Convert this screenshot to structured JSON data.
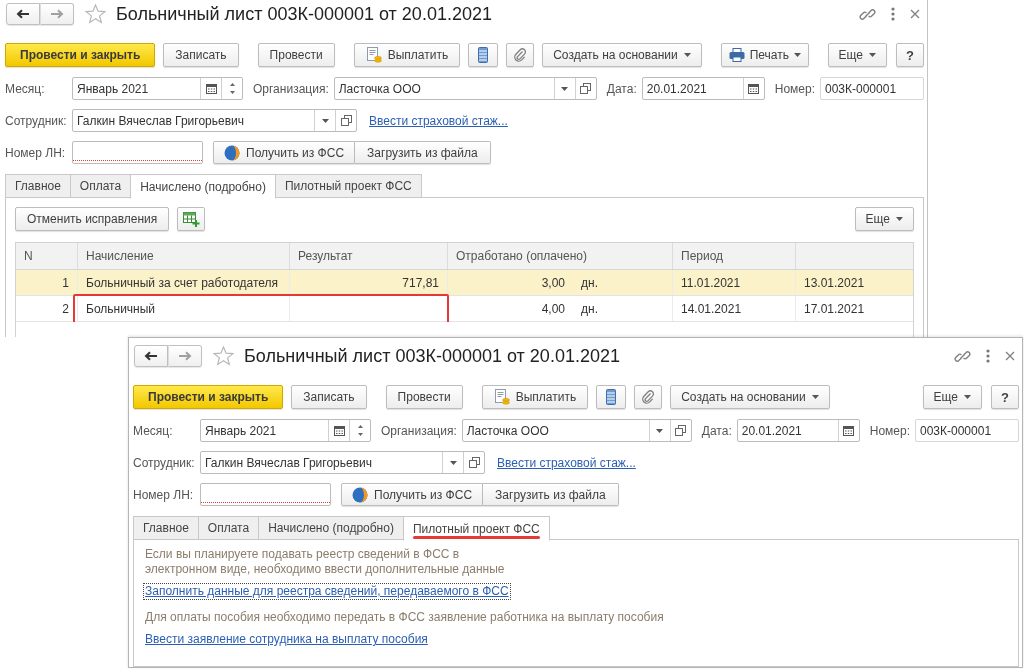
{
  "windows": [
    {
      "nav_buttons": [
        {
          "kind": "back",
          "disabled": false
        },
        {
          "kind": "forward",
          "disabled": true
        }
      ],
      "title": "Больничный лист 003К-000001 от 20.01.2021",
      "toolbar": [
        {
          "kind": "default",
          "label": "Провести и закрыть"
        },
        {
          "kind": "plain",
          "label": "Записать"
        },
        {
          "kind": "plain",
          "label": "Провести"
        },
        {
          "kind": "pay",
          "label": "Выплатить"
        },
        {
          "kind": "list"
        },
        {
          "kind": "attach"
        },
        {
          "kind": "menu",
          "label": "Создать на основании"
        },
        {
          "kind": "print",
          "label": "Печать"
        }
      ],
      "toolbar_right": [
        {
          "kind": "menu",
          "label": "Еще"
        },
        {
          "kind": "plain",
          "label": "?"
        }
      ],
      "month": {
        "label": "Месяц:",
        "value": "Январь 2021"
      },
      "organization": {
        "label": "Организация:",
        "value": "Ласточка ООО"
      },
      "date": {
        "label": "Дата:",
        "value": "20.01.2021"
      },
      "number": {
        "label": "Номер:",
        "value": "003К-000001"
      },
      "employee": {
        "label": "Сотрудник:",
        "value": "Галкин Вячеслав Григорьевич"
      },
      "insurance_link": "Ввести страховой стаж...",
      "sick_leave_number": {
        "label": "Номер ЛН:",
        "required": true
      },
      "fss_buttons": [
        {
          "kind": "fss",
          "label": "Получить из ФСС"
        },
        {
          "kind": "plain",
          "label": "Загрузить из файла"
        }
      ],
      "tabs": [
        {
          "label": "Главное",
          "selected": false,
          "marked": false
        },
        {
          "label": "Оплата",
          "selected": false,
          "marked": false
        },
        {
          "label": "Начислено (подробно)",
          "selected": true,
          "marked": false
        },
        {
          "label": "Пилотный проект ФСС",
          "selected": false,
          "marked": false
        }
      ],
      "body": {
        "kind": "accruals",
        "toolbar": [
          {
            "kind": "plain",
            "label": "Отменить исправления"
          },
          {
            "kind": "add"
          }
        ],
        "toolbar_right": [
          {
            "kind": "menu",
            "label": "Еще"
          }
        ],
        "columns": [
          "N",
          "Начисление",
          "Результат",
          "Отработано (оплачено)",
          "Период"
        ],
        "rows": [
          {
            "selected": true,
            "marked": false,
            "n": "1",
            "accrual": "Больничный за счет работодателя",
            "result": "717,81",
            "worked": "3,00",
            "unit": "дн.",
            "period": "11.01.2021",
            "column_7": "13.01.2021"
          },
          {
            "selected": false,
            "marked": true,
            "n": "2",
            "accrual": "Больничный",
            "worked": "4,00",
            "unit": "дн.",
            "period": "14.01.2021",
            "column_7": "17.01.2021"
          }
        ]
      }
    },
    {
      "nav_buttons": [
        {
          "kind": "back",
          "disabled": false
        },
        {
          "kind": "forward",
          "disabled": true
        }
      ],
      "title": "Больничный лист 003К-000001 от 20.01.2021",
      "toolbar": [
        {
          "kind": "default",
          "label": "Провести и закрыть"
        },
        {
          "kind": "plain",
          "label": "Записать"
        },
        {
          "kind": "plain",
          "label": "Провести"
        },
        {
          "kind": "pay",
          "label": "Выплатить"
        },
        {
          "kind": "list"
        },
        {
          "kind": "attach"
        },
        {
          "kind": "menu",
          "label": "Создать на основании"
        }
      ],
      "toolbar_right": [
        {
          "kind": "menu",
          "label": "Еще"
        },
        {
          "kind": "plain",
          "label": "?"
        }
      ],
      "month": {
        "label": "Месяц:",
        "value": "Январь 2021"
      },
      "organization": {
        "label": "Организация:",
        "value": "Ласточка ООО"
      },
      "date": {
        "label": "Дата:",
        "value": "20.01.2021"
      },
      "number": {
        "label": "Номер:",
        "value": "003К-000001"
      },
      "employee": {
        "label": "Сотрудник:",
        "value": "Галкин Вячеслав Григорьевич"
      },
      "insurance_link": "Ввести страховой стаж...",
      "sick_leave_number": {
        "label": "Номер ЛН:",
        "required": true
      },
      "fss_buttons": [
        {
          "kind": "fss",
          "label": "Получить из ФСС"
        },
        {
          "kind": "plain",
          "label": "Загрузить из файла"
        }
      ],
      "tabs": [
        {
          "label": "Главное",
          "selected": false,
          "marked": false
        },
        {
          "label": "Оплата",
          "selected": false,
          "marked": false
        },
        {
          "label": "Начислено (подробно)",
          "selected": false,
          "marked": false
        },
        {
          "label": "Пилотный проект ФСС",
          "selected": true,
          "marked": true
        }
      ],
      "body": {
        "kind": "notes",
        "items": [
          {
            "kind": "text",
            "text": "Если вы планируете подавать реестр сведений в ФСС в электронном виде, необходимо ввести дополнительные данные"
          },
          {
            "kind": "link",
            "text": "Заполнить данные для реестра сведений, передаваемого в ФСС",
            "focused": true
          },
          {
            "kind": "text",
            "text": "Для оплаты пособия необходимо передать в ФСС заявление работника на выплату пособия"
          },
          {
            "kind": "link",
            "text": "Ввести заявление сотрудника на выплату пособия",
            "focused": false
          }
        ]
      }
    }
  ]
}
